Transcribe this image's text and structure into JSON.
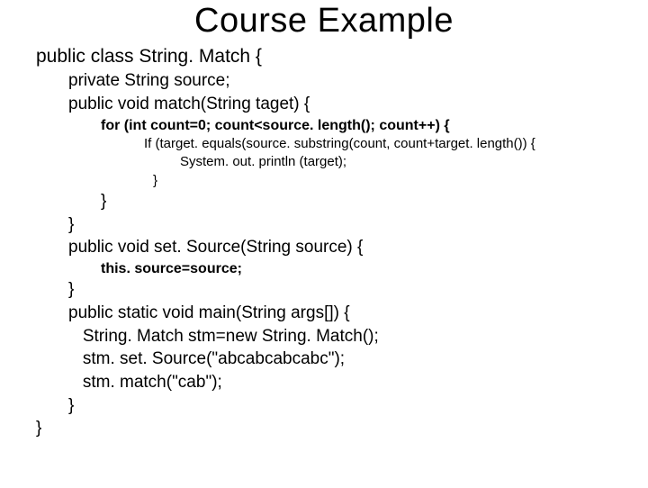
{
  "title": "Course Example",
  "code": {
    "l01": "public class String. Match {",
    "l02": "private String source;",
    "l03": "public void match(String taget) {",
    "l04": "for (int count=0; count<source. length(); count++) {",
    "l05": "If (target. equals(source. substring(count, count+target. length()) {",
    "l06": "System. out. println (target);",
    "l07": "}",
    "l08": "}",
    "l09": "}",
    "l10": "public void set. Source(String source) {",
    "l11": "this. source=source;",
    "l12": "}",
    "l13": "public static void main(String args[]) {",
    "l14": "   String. Match stm=new String. Match();",
    "l15": "   stm. set. Source(\"abcabcabcabc\");",
    "l16": "   stm. match(\"cab\");",
    "l17": "}",
    "l18": "}"
  }
}
